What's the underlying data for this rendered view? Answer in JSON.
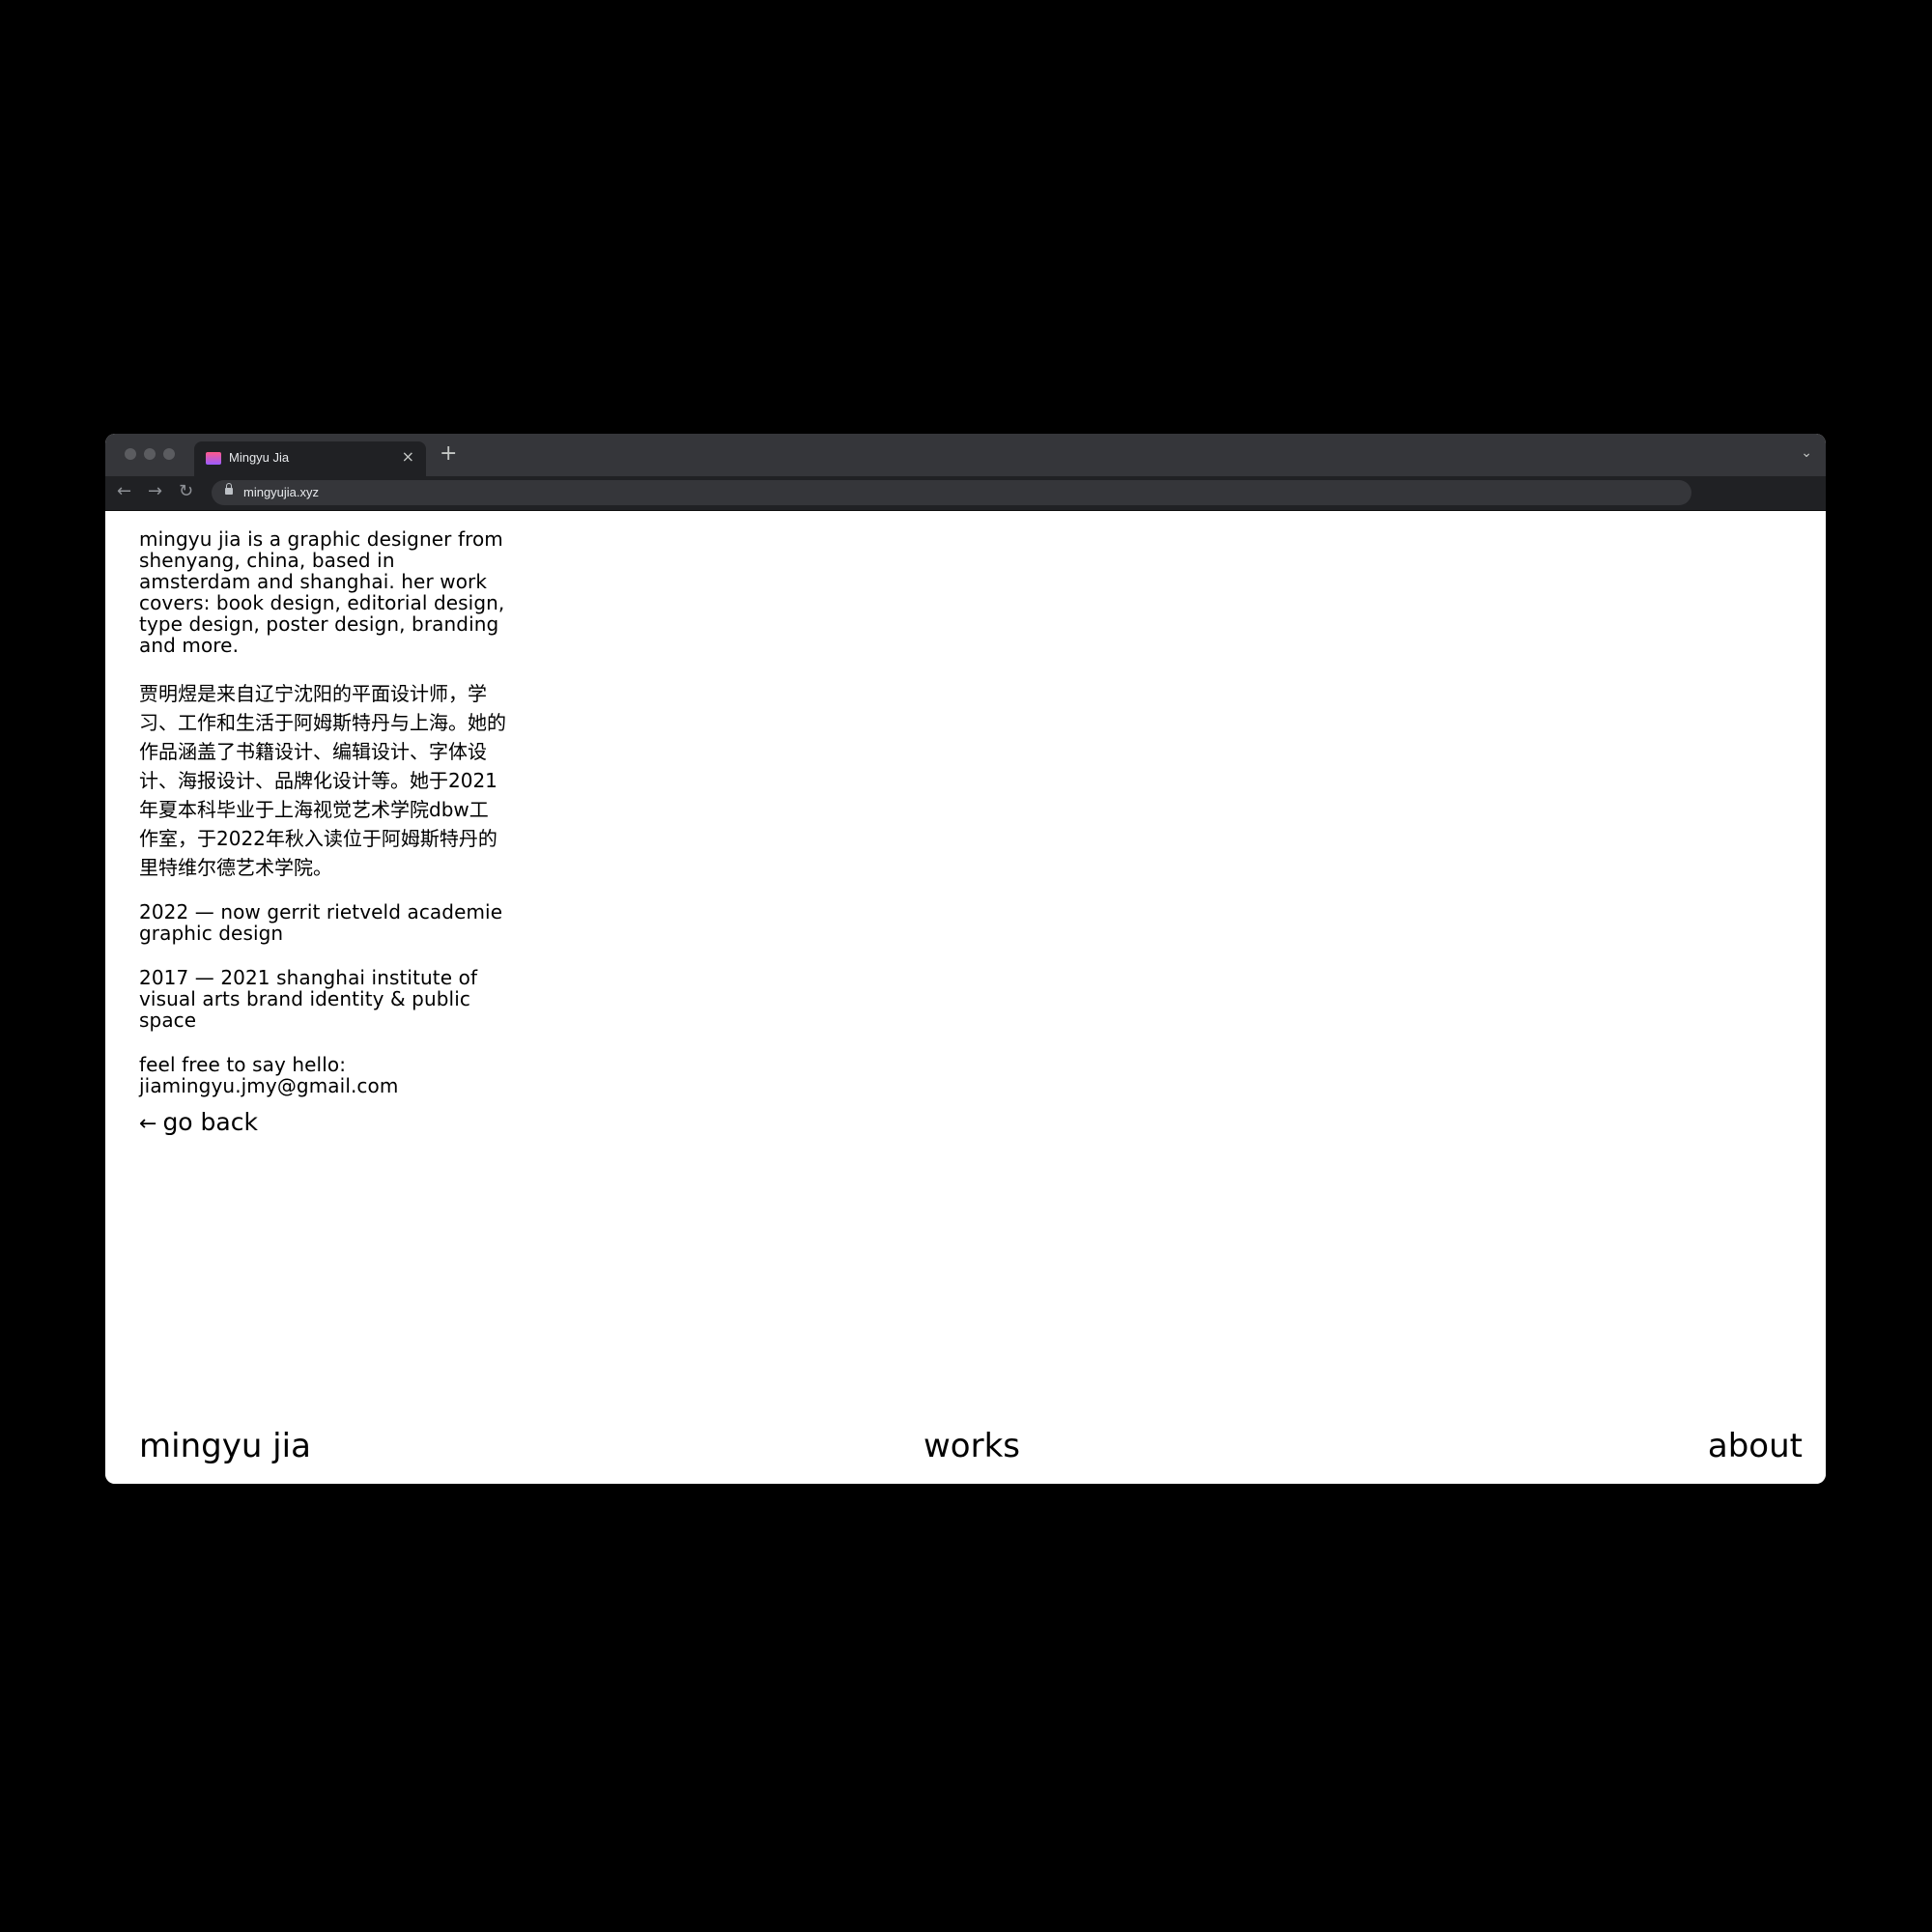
{
  "browser": {
    "tab_title": "Mingyu Jia",
    "tab_close": "×",
    "new_tab": "+",
    "tab_menu": "⌄",
    "back": "←",
    "forward": "→",
    "reload": "↻",
    "url": "mingyujia.xyz"
  },
  "about": {
    "bio_en": "mingyu jia is a graphic designer from shenyang, china, based in amsterdam and shanghai. her work covers: book design, editorial design, type design, poster design, branding and more.",
    "bio_zh": "贾明煜是来自辽宁沈阳的平面设计师，学习、工作和生活于阿姆斯特丹与上海。她的作品涵盖了书籍设计、编辑设计、字体设计、海报设计、品牌化设计等。她于2021年夏本科毕业于上海视觉艺术学院dbw工作室，于2022年秋入读位于阿姆斯特丹的里特维尔德艺术学院。",
    "education": [
      "2022 — now gerrit rietveld academie graphic design",
      "2017 — 2021 shanghai institute of visual arts brand identity & public space"
    ],
    "contact_prompt": "feel free to say hello:",
    "email": "jiamingyu.jmy@gmail.com",
    "go_back": "go back",
    "go_back_arrow": "←"
  },
  "nav": {
    "home": "mingyu jia",
    "works": "works",
    "about": "about"
  }
}
